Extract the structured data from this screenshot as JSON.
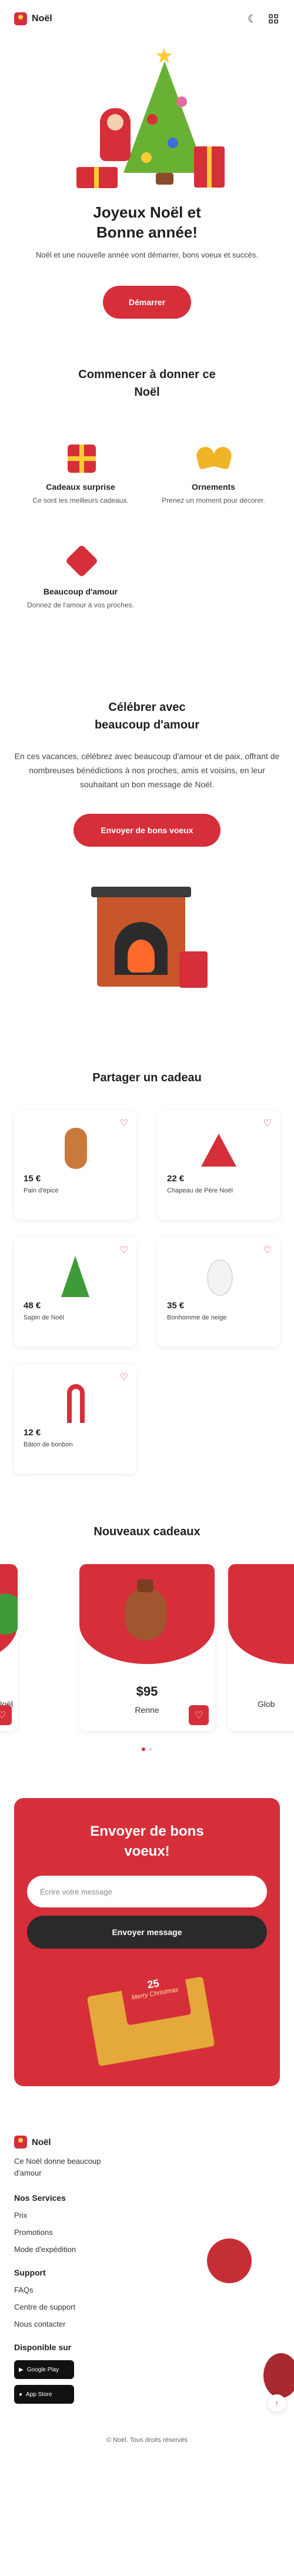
{
  "header": {
    "brand": "Noël",
    "theme_icon": "moon-icon",
    "menu_icon": "grid-icon"
  },
  "hero": {
    "title_line1": "Joyeux Noël et",
    "title_line2": "Bonne année!",
    "subtitle": "Noël et une nouvelle année vont démarrer, bons voeux et succès.",
    "cta": "Démarrer"
  },
  "features": {
    "title_line1": "Commencer à donner ce",
    "title_line2": "Noël",
    "items": [
      {
        "title": "Cadeaux surprise",
        "desc": "Ce sont les meilleurs cadeaux."
      },
      {
        "title": "Ornements",
        "desc": "Prenez un moment pour décorer."
      },
      {
        "title": "Beaucoup d'amour",
        "desc": "Donnez de l'amour à vos proches."
      }
    ]
  },
  "celebrate": {
    "title_line1": "Célébrer avec",
    "title_line2": "beaucoup d'amour",
    "text": "En ces vacances, célébrez avec beaucoup d'amour et de paix, offrant de nombreuses bénédictions à nos proches, amis et voisins, en leur souhaitant un bon message de Noël.",
    "cta": "Envoyer de bons voeux"
  },
  "gifts": {
    "title": "Partager un cadeau",
    "items": [
      {
        "price": "15 €",
        "name": "Pain d'épice"
      },
      {
        "price": "22 €",
        "name": "Chapeau de Père Noël"
      },
      {
        "price": "48 €",
        "name": "Sapin de Noël"
      },
      {
        "price": "35 €",
        "name": "Bonhomme de neige"
      },
      {
        "price": "12 €",
        "name": "Bâton de bonbon"
      }
    ]
  },
  "new_gifts": {
    "title": "Nouveaux cadeaux",
    "left_partial": "Noël",
    "main_price": "$95",
    "main_name": "Renne",
    "right_partial": "Glob"
  },
  "wishes": {
    "title_line1": "Envoyer de bons",
    "title_line2": "voeux!",
    "placeholder": "Écrire votre message",
    "button": "Envoyer message",
    "card_number": "25",
    "card_text": "Merry Christmas"
  },
  "footer": {
    "brand": "Noël",
    "tagline": "Ce Noël donne beaucoup d'amour",
    "services_title": "Nos Services",
    "services": [
      "Prix",
      "Promotions",
      "Mode d'expédition"
    ],
    "support_title": "Support",
    "support": [
      "FAQs",
      "Centre de support",
      "Nous contacter"
    ],
    "available_title": "Disponible sur",
    "google_play": "Google Play",
    "app_store": "App Store",
    "copyright": "© Noël. Tous droits réservés"
  },
  "colors": {
    "accent": "#d62f3a",
    "dark": "#2a2a2a",
    "gold": "#ffcc33"
  }
}
